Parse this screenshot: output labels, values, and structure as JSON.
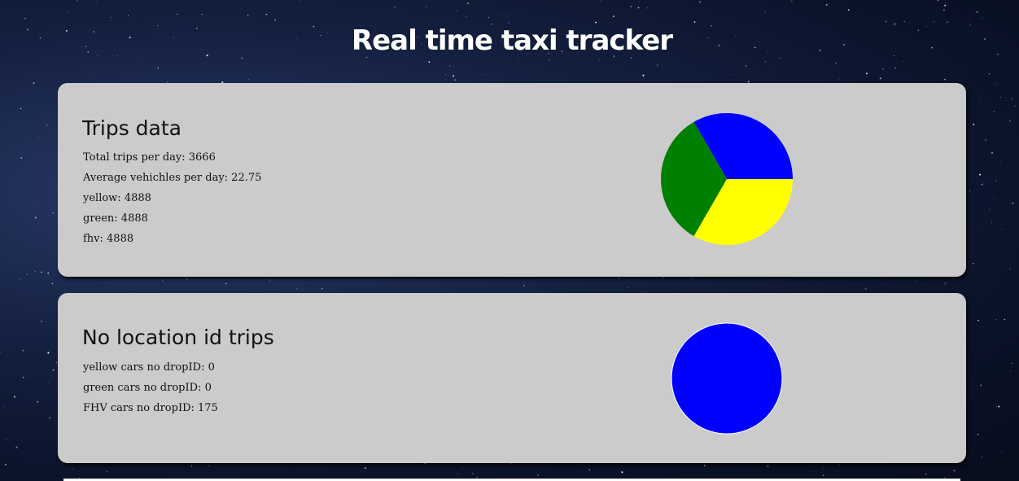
{
  "header": {
    "title": "Real time taxi tracker"
  },
  "trips_panel": {
    "heading": "Trips data",
    "stats": [
      "Total trips per day: 3666",
      "Average vehichles per day: 22.75",
      "yellow: 4888",
      "green: 4888",
      "fhv: 4888"
    ]
  },
  "noloc_panel": {
    "heading": "No location id trips",
    "stats": [
      "yellow cars no dropID: 0",
      "green cars no dropID: 0",
      "FHV cars no dropID: 175"
    ]
  },
  "chart_data": [
    {
      "type": "pie",
      "values": [
        4888,
        4888,
        4888
      ],
      "colors": [
        "#0000ff",
        "#ffff00",
        "#008000"
      ]
    },
    {
      "type": "pie",
      "values": [
        0,
        0,
        175
      ],
      "colors": [
        "#ffff00",
        "#008000",
        "#0000ff"
      ]
    }
  ]
}
